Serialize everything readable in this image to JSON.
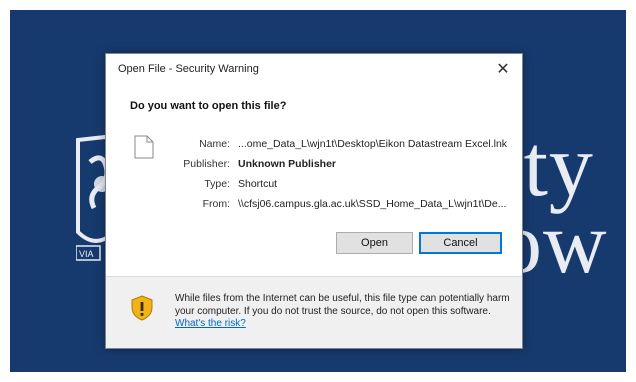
{
  "dialog": {
    "title": "Open File - Security Warning",
    "question": "Do you want to open this file?",
    "fields": [
      {
        "label": "Name:",
        "value": "...ome_Data_L\\wjn1t\\Desktop\\Eikon Datastream Excel.lnk"
      },
      {
        "label": "Publisher:",
        "value": "Unknown Publisher"
      },
      {
        "label": "Type:",
        "value": "Shortcut"
      },
      {
        "label": "From:",
        "value": "\\\\cfsj06.campus.gla.ac.uk\\SSD_Home_Data_L\\wjn1t\\De..."
      }
    ],
    "buttons": {
      "open": "Open",
      "cancel": "Cancel"
    },
    "warning": {
      "text": "While files from the Internet can be useful, this file type can potentially harm your computer. If you do not trust the source, do not open this software.",
      "link": "What's the risk?"
    },
    "icons": {
      "close": "close-icon",
      "file": "file-icon",
      "shield": "shield-warning-icon"
    }
  },
  "background": {
    "text_top": "ity",
    "text_bottom": "ow",
    "crest_text": "VIA",
    "color": "#173a6e"
  }
}
